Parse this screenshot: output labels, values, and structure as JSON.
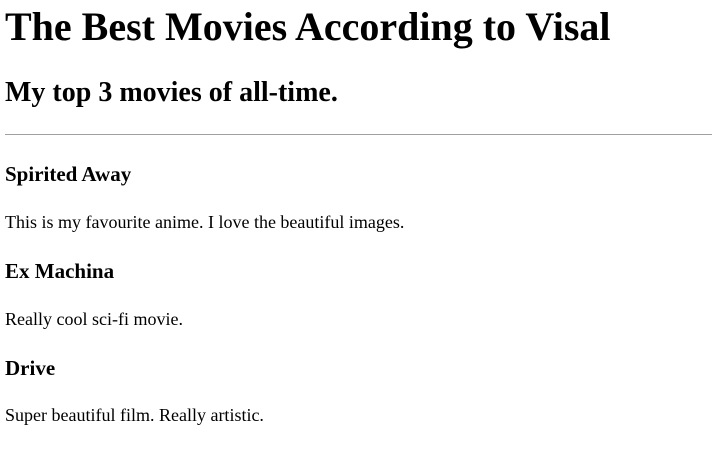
{
  "header": {
    "title": "The Best Movies According to Visal",
    "subtitle": "My top 3 movies of all-time."
  },
  "movies": [
    {
      "title": "Spirited Away",
      "description": "This is my favourite anime. I love the beautiful images."
    },
    {
      "title": "Ex Machina",
      "description": "Really cool sci-fi movie."
    },
    {
      "title": "Drive",
      "description": "Super beautiful film. Really artistic."
    }
  ]
}
